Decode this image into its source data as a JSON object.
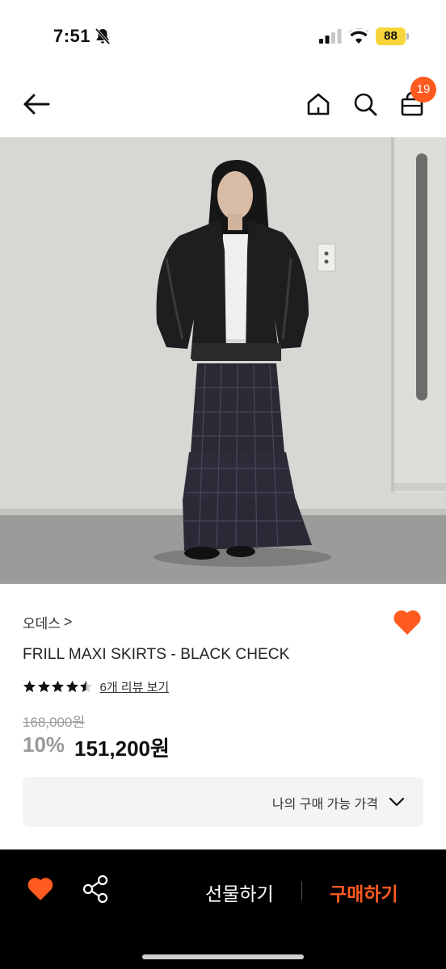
{
  "status_bar": {
    "time": "7:51",
    "battery": "88"
  },
  "header": {
    "cart_count": "19",
    "icons": [
      "back-arrow-icon",
      "home-icon",
      "search-icon",
      "shopping-bag-icon"
    ]
  },
  "product": {
    "brand": "오데스",
    "brand_chevron": ">",
    "title": "FRILL MAXI SKIRTS - BLACK CHECK",
    "rating": 4.5,
    "review_link": "6개 리뷰 보기",
    "original_price": "168,000원",
    "discount": "10%",
    "sale_price": "151,200원",
    "my_price_label": "나의 구매 가능 가격"
  },
  "bottom_bar": {
    "gift_label": "선물하기",
    "buy_label": "구매하기"
  },
  "colors": {
    "accent": "#ff5a1f",
    "battery": "#f6d53a",
    "bottom_bar": "#000000",
    "price_box": "#f4f4f4"
  }
}
